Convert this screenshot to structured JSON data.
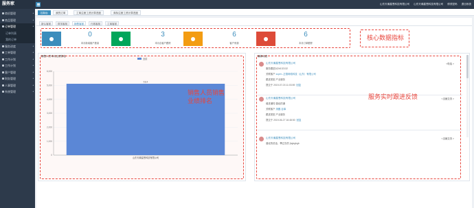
{
  "brand": "服务家",
  "sidebar": {
    "items": [
      {
        "label": "商机管理",
        "active": false
      },
      {
        "label": "商品管理",
        "active": false
      },
      {
        "label": "订单管理",
        "active": true
      },
      {
        "label": "订单列表",
        "sub": true
      },
      {
        "label": "我的订单",
        "sub": true
      },
      {
        "label": "服务进度",
        "active": false
      },
      {
        "label": "工单管理",
        "active": false
      },
      {
        "label": "工作计划",
        "active": false
      },
      {
        "label": "工作计划",
        "active": false
      },
      {
        "label": "客户管理",
        "active": false
      },
      {
        "label": "财务管理",
        "active": false
      },
      {
        "label": "人事管理",
        "active": false
      },
      {
        "label": "系统管理",
        "active": false
      }
    ]
  },
  "topbar": {
    "company": "山东天瀚星恩科技有限公司",
    "company2": "山东天瀚星恩科技有限公司",
    "change_password": "修改密码",
    "logout": "退出系统"
  },
  "page_tabs": [
    {
      "label": "控制台",
      "active": true
    },
    {
      "label": "我的订单",
      "active": false
    },
    {
      "label": "工商注册工资计算进度",
      "active": false
    },
    {
      "label": "商标注册工资计算进度",
      "active": false
    }
  ],
  "sub_tabs": [
    {
      "label": "新认客航",
      "active": false
    },
    {
      "label": "财务客航",
      "active": false
    },
    {
      "label": "销售客航",
      "active": true
    },
    {
      "label": "行政客航",
      "active": false
    },
    {
      "label": "工商客航",
      "active": false
    }
  ],
  "stats": [
    {
      "value": "0",
      "label": "本月新增客户数量",
      "color": "#3c8dbc",
      "icon": "users-icon"
    },
    {
      "value": "3",
      "label": "本月合客户跟踪",
      "color": "#00a65a",
      "icon": "plus-circle-icon"
    },
    {
      "value": "6",
      "label": "客户来源",
      "color": "#f39c12",
      "icon": "question-circle-icon"
    },
    {
      "value": "6",
      "label": "本月订单跟踪",
      "color": "#dd4b39",
      "icon": "file-icon"
    }
  ],
  "callouts": {
    "core": "核心数据指标",
    "sales_line1": "销售人员销售",
    "sales_line2": "业绩排名",
    "service": "服务实时跟进反馈"
  },
  "chart_panel_title": "销售人员本月业绩排名",
  "chart_data": {
    "type": "bar",
    "legend": [
      "业绩"
    ],
    "categories": [
      "山东天瀚星恩科技有限公司"
    ],
    "values": [
      5114
    ],
    "data_labels": [
      "5114"
    ],
    "ylim": [
      0,
      6000
    ],
    "yticks": [
      "0",
      "1,000",
      "2,000",
      "3,000",
      "4,000",
      "5,000",
      "6,000"
    ],
    "color": "#5b87d6"
  },
  "feed_panel_title": "最新动态",
  "feed": [
    {
      "name": "山东天瀚星恩科技有限公司",
      "lines": [
        "服务跟进对2#132132",
        "关联客户 super--正德网络科技（山东）有限公司",
        "跟进类型 产业服务",
        "提交于 2019-07-03 11:03:59"
      ],
      "link_line": 1,
      "link_text": "super--正德网络科技（山东）有限公司",
      "time_link": "回复",
      "action": "<电话 >"
    },
    {
      "name": "山东天瀚星恩科技有限公司",
      "lines": [
        "增进通知 曾经的通",
        "关联客户 测图-百事",
        "跟进类型 产业服务",
        "提交于 2019-06-27 16:48:50"
      ],
      "link_line": 1,
      "link_text": "测图-百事",
      "time_link": "回复",
      "action": "<当面交流 >"
    },
    {
      "name": "山东天瀚星恩科技有限公司",
      "lines": [
        "曾经的说话，攀过去的 jhgbgbgb"
      ],
      "link_line": -1,
      "link_text": "",
      "time_link": "",
      "action": "<当面交流 >"
    }
  ]
}
